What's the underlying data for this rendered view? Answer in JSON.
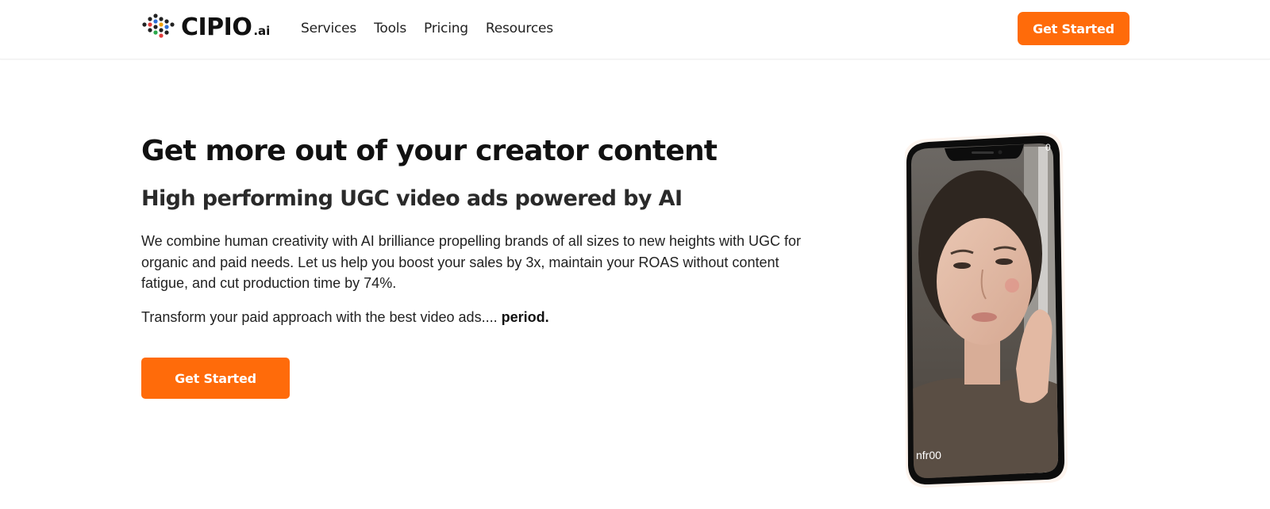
{
  "header": {
    "logo": {
      "name": "CIPIO",
      "suffix": ".ai"
    },
    "nav": [
      {
        "label": "Services"
      },
      {
        "label": "Tools"
      },
      {
        "label": "Pricing"
      },
      {
        "label": "Resources"
      }
    ],
    "cta_label": "Get Started"
  },
  "hero": {
    "title": "Get more out of your creator content",
    "subtitle": "High performing UGC video ads powered by AI",
    "description": "We combine human creativity with AI brilliance propelling brands of all sizes to new heights with UGC for organic and paid needs. Let us help you boost your sales by 3x, maintain your ROAS without content fatigue, and cut production time by 74%.",
    "tagline": "Transform your paid approach with the best video ads....",
    "tagline_emphasis": "period.",
    "cta_label": "Get Started"
  },
  "phone": {
    "handle": "nfr00",
    "counter": "0"
  },
  "colors": {
    "accent": "#ff6b0a",
    "text": "#111111"
  }
}
